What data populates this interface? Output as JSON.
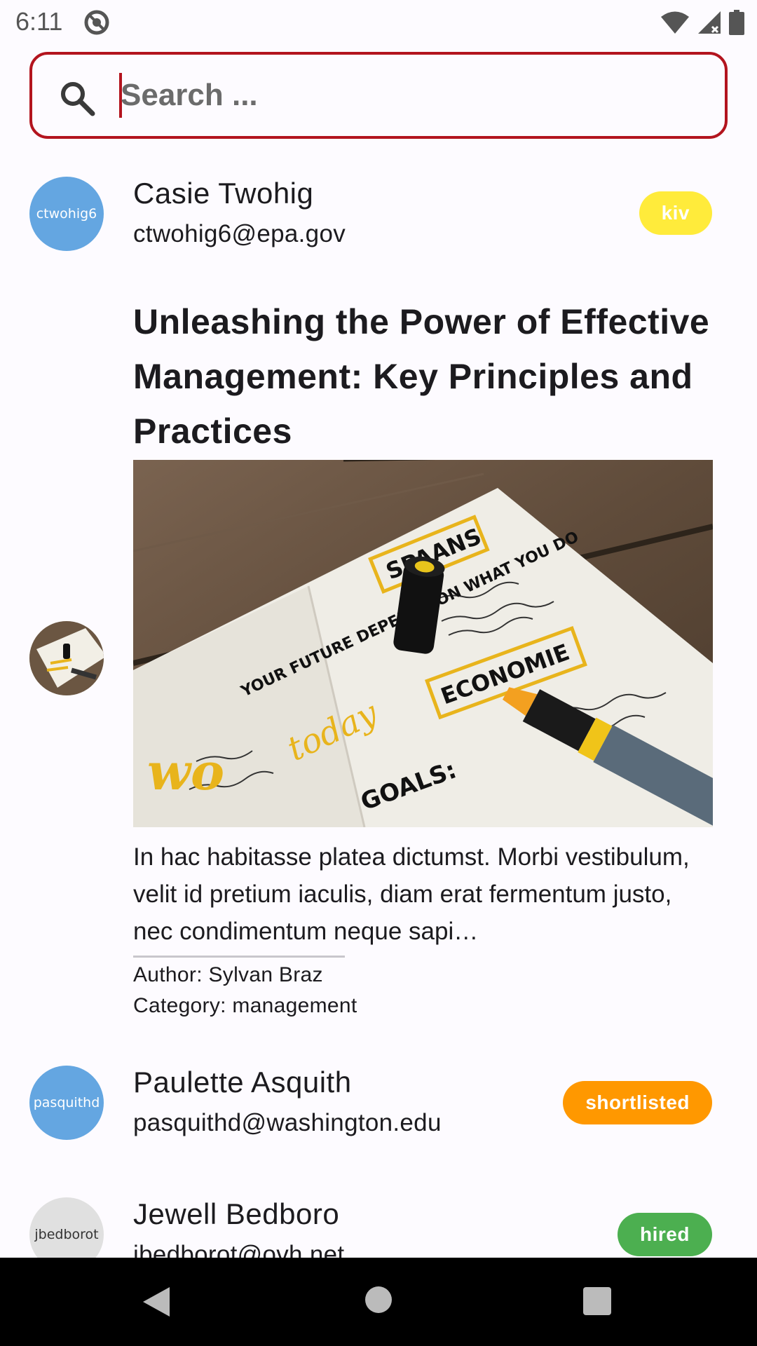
{
  "status_bar": {
    "time": "6:11"
  },
  "search": {
    "placeholder": "Search ..."
  },
  "list": {
    "item1": {
      "avatar_text": "ctwohig6",
      "name": "Casie Twohig",
      "email": "ctwohig6@epa.gov",
      "badge": "kiv",
      "badge_color": "#ffeb3b"
    },
    "article": {
      "title": "Unleashing the Power of Effective Management: Key Principles and Practices",
      "body": "In hac habitasse platea dictumst. Morbi vestibulum, velit id pretium iaculis, diam erat fermentum justo, nec condimentum neque sapi…",
      "author": "Author: Sylvan Braz",
      "category": "Category: management",
      "image_text": {
        "spaans": "SPAANS",
        "economie": "ECONOMIE",
        "future": "YOUR FUTURE DEPENDS ON WHAT YOU DO",
        "today": "today",
        "goals": "GOALS:"
      }
    },
    "item2": {
      "avatar_text": "pasquithd",
      "name": "Paulette Asquith",
      "email": "pasquithd@washington.edu",
      "badge": "shortlisted",
      "badge_color": "#ff9800"
    },
    "item3": {
      "avatar_text": "jbedborot",
      "name": "Jewell Bedboro",
      "email": "jbedborot@ovh.net",
      "badge": "hired",
      "badge_color": "#4caf50"
    }
  },
  "colors": {
    "accent": "#b3141e",
    "avatar_blue": "#64a6e1",
    "avatar_grey": "#e0e0e0"
  }
}
